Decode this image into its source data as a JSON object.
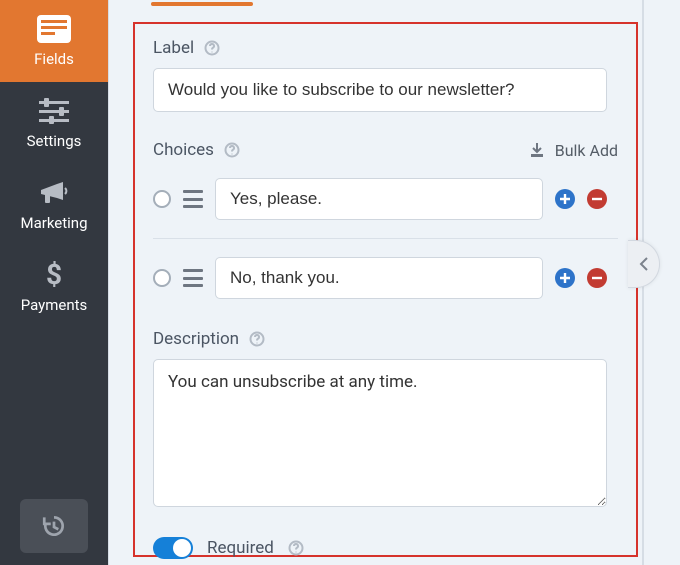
{
  "sidebar": {
    "items": [
      {
        "label": "Fields"
      },
      {
        "label": "Settings"
      },
      {
        "label": "Marketing"
      },
      {
        "label": "Payments"
      }
    ]
  },
  "panel": {
    "label_section": "Label",
    "label_value": "Would you like to subscribe to our newsletter?",
    "choices_section": "Choices",
    "bulk_add": "Bulk Add",
    "choices": [
      {
        "value": "Yes, please."
      },
      {
        "value": "No, thank you."
      }
    ],
    "description_section": "Description",
    "description_value": "You can unsubscribe at any time.",
    "required_label": "Required",
    "required_on": true
  }
}
